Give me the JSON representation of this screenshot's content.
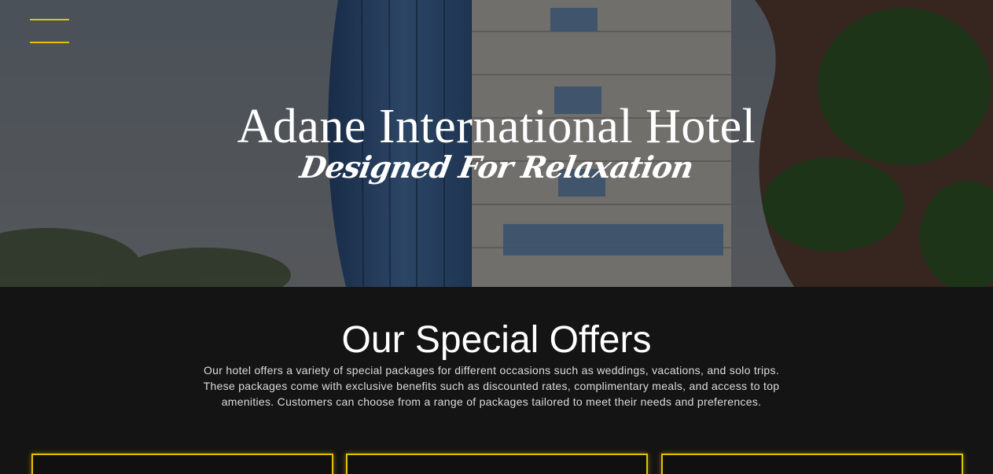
{
  "colors": {
    "accent": "#e5c100",
    "section_bg": "#141414",
    "text": "#ffffff"
  },
  "header": {
    "menu_icon": "hamburger-menu-icon"
  },
  "hero": {
    "title": "Adane International Hotel",
    "tagline": "Designed For Relaxation"
  },
  "offers": {
    "title": "Our Special Offers",
    "description": "Our hotel offers a variety of special packages for different occasions such as weddings, vacations, and solo trips. These packages come with exclusive benefits such as discounted rates, complimentary meals, and access to top amenities. Customers can choose from a range of packages tailored to meet their needs and preferences.",
    "cards": [
      "",
      "",
      ""
    ]
  }
}
